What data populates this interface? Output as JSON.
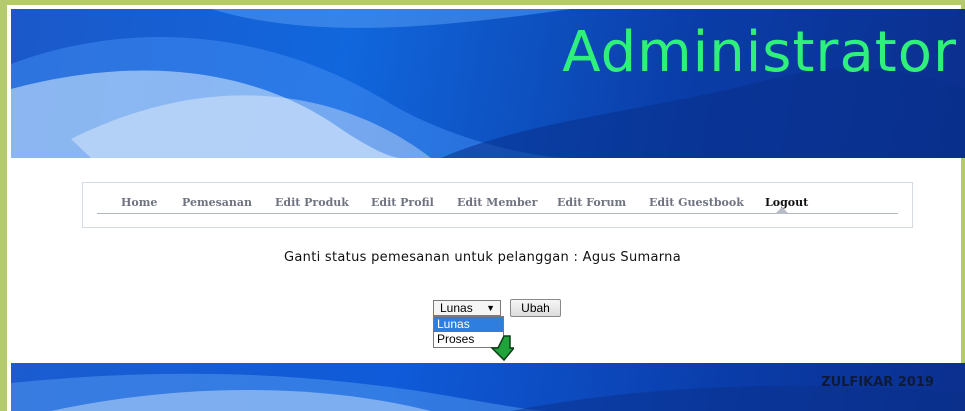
{
  "banner": {
    "title": "Administrator"
  },
  "nav": {
    "items": [
      {
        "label": "Home"
      },
      {
        "label": "Pemesanan"
      },
      {
        "label": "Edit Produk"
      },
      {
        "label": "Edit Profil"
      },
      {
        "label": "Edit Member"
      },
      {
        "label": "Edit Forum"
      },
      {
        "label": "Edit Guestbook"
      },
      {
        "label": "Logout"
      }
    ],
    "active": "Logout"
  },
  "main": {
    "message": "Ganti status pemesanan untuk pelanggan : Agus Sumarna",
    "status_select": {
      "selected": "Lunas",
      "options": [
        "Lunas",
        "Proses"
      ],
      "highlighted": "Lunas"
    },
    "submit_label": "Ubah"
  },
  "footer": {
    "text": "ZULFIKAR 2019"
  },
  "colors": {
    "frame_border": "#b5c96f",
    "banner_blue": "#1167dd",
    "title_green": "#2ff07a",
    "highlight": "#2e7ee0"
  }
}
